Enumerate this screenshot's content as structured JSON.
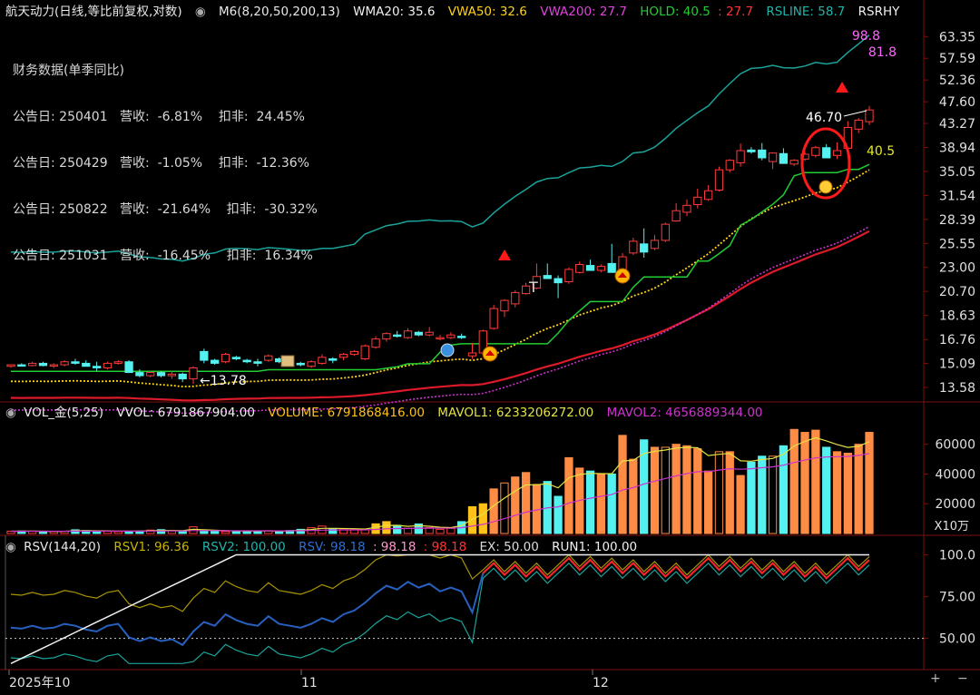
{
  "main_header": {
    "stock": "航天动力(日线,等比前复权,对数)",
    "m6": "M6(8,20,50,200,13)",
    "wma20": "WMA20: 35.6",
    "vwa50": "VWA50: 32.6",
    "vwa200": "VWA200: 27.7",
    "hold": "HOLD: 40.5",
    "hold2": ": 27.7",
    "rsline": "RSLINE: 58.7",
    "rsrhy": "RSRHY"
  },
  "financials": {
    "title": "财务数据(单季同比)",
    "rows": [
      "公告日: 250401   营收:  -6.81%    扣非:  24.45%",
      "公告日: 250429   营收:  -1.05%    扣非:  -12.36%",
      "公告日: 250822   营收:  -21.64%    扣非:  -30.32%",
      "公告日: 251031   营收:  -16.45%    扣非:  16.34%"
    ]
  },
  "annotations": {
    "rs_top": "98.8",
    "rs_top2": "81.8",
    "high": "46.70",
    "hold_tag": "40.5",
    "low": "13.78"
  },
  "price_axis": [
    "63.35",
    "57.59",
    "52.36",
    "47.60",
    "43.27",
    "38.94",
    "35.05",
    "31.54",
    "28.39",
    "25.55",
    "23.00",
    "20.70",
    "18.63",
    "16.76",
    "15.09",
    "13.58"
  ],
  "vol_header": {
    "name": "VOL_金(5,25)",
    "vvol": "VVOL: 6791867904.00",
    "volume": "VOLUME: 6791868416.00",
    "mavol1": "MAVOL1: 6233206272.00",
    "mavol2": "MAVOL2: 4656889344.00"
  },
  "vol_axis": [
    "60000",
    "40000",
    "20000"
  ],
  "vol_unit": "X10万",
  "rsv_header": {
    "name": "RSV(144,20)",
    "rsv1": "RSV1: 96.36",
    "rsv2": "RSV2: 100.00",
    "rsv": "RSV: 98.18",
    "c1": ": 98.18",
    "c2": ": 98.18",
    "ex": "EX: 50.00",
    "run1": "RUN1: 100.00"
  },
  "rsv_axis": [
    "100.0",
    "75.00",
    "50.00"
  ],
  "x_axis": [
    "2025年10",
    "11",
    "12"
  ],
  "buttons": {
    "plus": "+",
    "minus": "−"
  },
  "colors": {
    "up": "#ff3b3b",
    "down": "#54f1f1",
    "orange": "#ff8c44",
    "gold": "#ffc21a",
    "hold": "#22cc33",
    "rs": "#1aa39a",
    "vwa50": "#ffd21a",
    "vwa200": "#cc33cc",
    "wma20": "#dd1a2a"
  },
  "chart_data": {
    "type": "candlestick",
    "title": "航天动力(日线,等比前复权,对数)",
    "y_scale": "log",
    "ylim": [
      13.0,
      66.0
    ],
    "candles": [
      [
        14.9,
        15.0,
        14.8,
        15.0
      ],
      [
        15.0,
        15.1,
        14.9,
        14.95
      ],
      [
        14.95,
        15.2,
        14.9,
        15.1
      ],
      [
        15.1,
        15.2,
        14.9,
        14.95
      ],
      [
        14.95,
        15.1,
        14.8,
        15.0
      ],
      [
        15.0,
        15.3,
        14.9,
        15.2
      ],
      [
        15.2,
        15.4,
        15.0,
        15.1
      ],
      [
        15.1,
        15.3,
        14.9,
        14.9
      ],
      [
        14.9,
        15.2,
        14.6,
        14.8
      ],
      [
        14.8,
        15.2,
        14.7,
        15.1
      ],
      [
        15.1,
        15.3,
        15.0,
        15.2
      ],
      [
        15.2,
        15.3,
        14.5,
        14.5
      ],
      [
        14.5,
        14.7,
        14.2,
        14.3
      ],
      [
        14.3,
        14.6,
        14.2,
        14.5
      ],
      [
        14.5,
        14.6,
        14.2,
        14.3
      ],
      [
        14.3,
        14.6,
        14.1,
        14.4
      ],
      [
        14.4,
        14.5,
        13.9,
        14.1
      ],
      [
        14.1,
        14.9,
        13.78,
        14.8
      ],
      [
        15.9,
        16.1,
        15.1,
        15.3
      ],
      [
        15.3,
        15.4,
        15.0,
        15.1
      ],
      [
        15.2,
        15.8,
        15.1,
        15.7
      ],
      [
        15.5,
        15.6,
        15.3,
        15.4
      ],
      [
        15.3,
        15.4,
        15.1,
        15.2
      ],
      [
        15.2,
        15.4,
        14.9,
        15.1
      ],
      [
        15.3,
        15.7,
        15.2,
        15.6
      ],
      [
        15.4,
        15.5,
        15.1,
        15.2
      ],
      [
        15.3,
        15.4,
        15.0,
        15.1
      ],
      [
        15.1,
        15.2,
        14.9,
        15.0
      ],
      [
        14.9,
        15.3,
        14.8,
        15.2
      ],
      [
        15.1,
        15.7,
        15.0,
        15.5
      ],
      [
        15.4,
        15.5,
        15.1,
        15.3
      ],
      [
        15.5,
        15.8,
        15.3,
        15.7
      ],
      [
        15.7,
        16.0,
        15.6,
        15.9
      ],
      [
        15.4,
        16.4,
        15.3,
        16.3
      ],
      [
        16.2,
        17.0,
        16.1,
        16.8
      ],
      [
        16.8,
        17.3,
        16.6,
        17.2
      ],
      [
        17.1,
        17.4,
        16.9,
        17.0
      ],
      [
        16.9,
        17.6,
        16.8,
        17.4
      ],
      [
        17.3,
        17.4,
        17.0,
        17.1
      ],
      [
        17.1,
        17.7,
        17.0,
        17.3
      ],
      [
        16.9,
        17.1,
        16.7,
        16.9
      ],
      [
        16.9,
        17.3,
        16.8,
        17.1
      ],
      [
        17.0,
        17.2,
        16.8,
        16.9
      ],
      [
        15.6,
        16.5,
        15.4,
        15.8
      ],
      [
        15.8,
        17.5,
        15.7,
        17.4
      ],
      [
        17.6,
        19.5,
        17.5,
        19.2
      ],
      [
        19.0,
        20.0,
        18.5,
        19.9
      ],
      [
        19.6,
        20.8,
        19.3,
        20.6
      ],
      [
        20.5,
        21.5,
        20.4,
        21.2
      ],
      [
        21.0,
        23.4,
        20.9,
        22.1
      ],
      [
        22.2,
        23.4,
        22.1,
        21.9
      ],
      [
        21.9,
        22.2,
        20.1,
        21.5
      ],
      [
        21.6,
        23.0,
        21.4,
        22.8
      ],
      [
        22.5,
        23.6,
        22.4,
        23.3
      ],
      [
        23.2,
        23.8,
        22.8,
        22.7
      ],
      [
        22.7,
        23.3,
        22.5,
        23.1
      ],
      [
        23.4,
        25.5,
        23.3,
        22.5
      ],
      [
        22.6,
        24.5,
        22.4,
        24.1
      ],
      [
        24.5,
        26.2,
        24.3,
        25.8
      ],
      [
        25.5,
        27.3,
        24.0,
        24.6
      ],
      [
        25.0,
        26.5,
        24.8,
        25.9
      ],
      [
        25.9,
        28.0,
        25.7,
        27.8
      ],
      [
        28.2,
        30.5,
        28.1,
        29.5
      ],
      [
        29.3,
        31.0,
        28.8,
        30.2
      ],
      [
        30.3,
        32.5,
        29.8,
        31.3
      ],
      [
        31.0,
        33.0,
        30.8,
        32.2
      ],
      [
        32.3,
        35.8,
        32.1,
        35.3
      ],
      [
        35.3,
        37.0,
        34.9,
        36.8
      ],
      [
        36.4,
        39.6,
        35.8,
        38.4
      ],
      [
        38.5,
        39.0,
        37.9,
        38.2
      ],
      [
        38.5,
        39.7,
        36.8,
        37.2
      ],
      [
        36.6,
        38.1,
        35.4,
        38.0
      ],
      [
        37.9,
        38.8,
        36.7,
        36.3
      ],
      [
        36.2,
        37.0,
        35.9,
        36.8
      ],
      [
        37.0,
        38.2,
        36.7,
        37.8
      ],
      [
        37.6,
        39.2,
        37.3,
        38.9
      ],
      [
        38.9,
        39.5,
        37.8,
        37.2
      ],
      [
        37.6,
        39.8,
        37.0,
        38.4
      ],
      [
        38.8,
        43.7,
        38.2,
        42.5
      ],
      [
        42.2,
        44.3,
        41.5,
        43.9
      ],
      [
        43.6,
        46.7,
        43.0,
        45.9
      ]
    ],
    "holdline_end": 40.5,
    "vwa50_end": 32.6,
    "vwa200_end": 27.7,
    "wma20_end": 35.6,
    "vol_ylim": [
      0,
      72000
    ],
    "volumes": [
      1500,
      1700,
      1600,
      1400,
      1300,
      1500,
      2500,
      2000,
      1700,
      1600,
      1300,
      1500,
      1700,
      2300,
      2600,
      1900,
      1800,
      4500,
      2000,
      1600,
      1300,
      1300,
      1600,
      1700,
      1900,
      1500,
      2000,
      2800,
      3900,
      5000,
      3400,
      3200,
      3000,
      2500,
      6500,
      8000,
      5500,
      3500,
      6400,
      4000,
      2800,
      3500,
      8000,
      18000,
      20000,
      30000,
      34000,
      38000,
      41000,
      33000,
      35000,
      25000,
      51000,
      44000,
      42000,
      40000,
      40000,
      66000,
      50000,
      63000,
      58000,
      58000,
      60000,
      59000,
      57000,
      42000,
      55000,
      55000,
      39000,
      48000,
      52000,
      52000,
      59000,
      70000,
      68000,
      69500,
      58000,
      55000,
      54000,
      60000,
      68000
    ],
    "rsv_ylim": [
      33,
      103
    ]
  }
}
